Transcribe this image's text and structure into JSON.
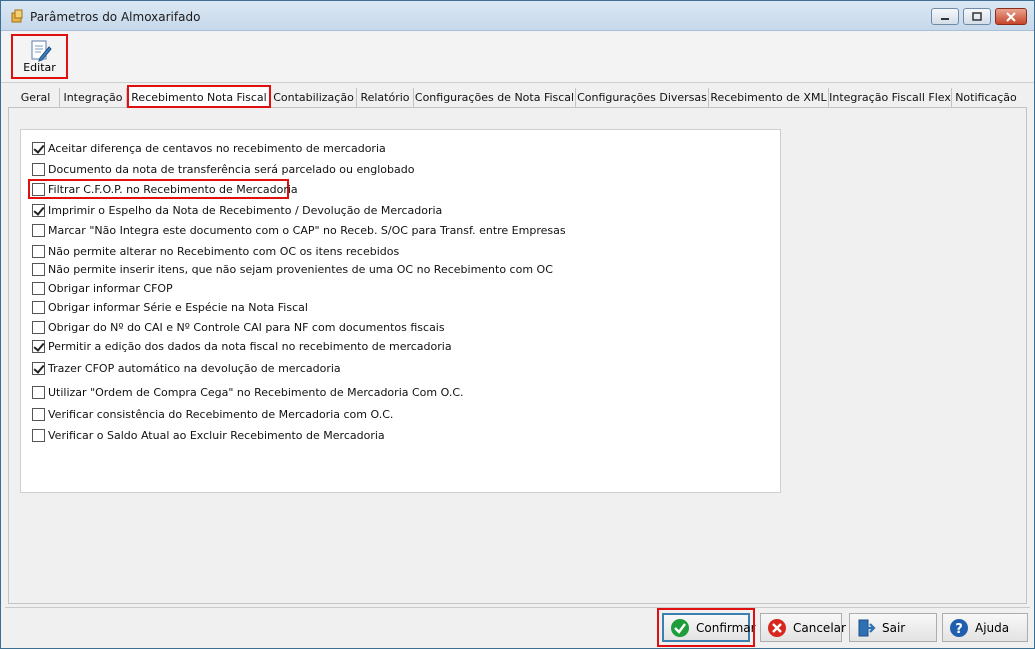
{
  "window": {
    "title": "Parâmetros do Almoxarifado"
  },
  "toolbar": {
    "edit_label": "Editar"
  },
  "tabs": [
    "Geral",
    "Integração",
    "Recebimento Nota Fiscal",
    "Contabilização",
    "Relatório",
    "Configurações de Nota Fiscal",
    "Configurações Diversas",
    "Recebimento de XML",
    "Integração Fiscall Flex",
    "Notificação"
  ],
  "active_tab": "Recebimento Nota Fiscal",
  "options": [
    {
      "label": "Aceitar diferença de centavos no recebimento de mercadoria",
      "checked": true
    },
    {
      "label": "Documento da nota de transferência será parcelado ou englobado",
      "checked": false
    },
    {
      "label": "Filtrar C.F.O.P. no Recebimento de Mercadoria",
      "checked": false
    },
    {
      "label": "Imprimir o Espelho da Nota de Recebimento / Devolução de Mercadoria",
      "checked": true
    },
    {
      "label": "Marcar \"Não Integra este documento com o CAP\" no Receb. S/OC para Transf. entre Empresas",
      "checked": false
    },
    {
      "label": "Não permite alterar no Recebimento com OC os itens recebidos",
      "checked": false
    },
    {
      "label": "Não permite inserir itens, que não sejam provenientes de uma OC no Recebimento com OC",
      "checked": false
    },
    {
      "label": "Obrigar informar CFOP",
      "checked": false
    },
    {
      "label": "Obrigar informar Série e Espécie na Nota Fiscal",
      "checked": false
    },
    {
      "label": "Obrigar do Nº do CAI e Nº Controle CAI para NF com documentos fiscais",
      "checked": false
    },
    {
      "label": "Permitir a edição dos dados da nota fiscal no recebimento de mercadoria",
      "checked": true
    },
    {
      "label": "Trazer CFOP automático na devolução de mercadoria",
      "checked": true
    },
    {
      "label": "Utilizar \"Ordem de Compra Cega\" no Recebimento de Mercadoria Com O.C.",
      "checked": false
    },
    {
      "label": "Verificar consistência do Recebimento de Mercadoria com O.C.",
      "checked": false
    },
    {
      "label": "Verificar o Saldo Atual ao Excluir Recebimento de Mercadoria",
      "checked": false
    }
  ],
  "footer": {
    "confirm_label": "Confirmar",
    "cancel_label": "Cancelar",
    "exit_label": "Sair",
    "help_label": "Ajuda"
  },
  "colors": {
    "highlight": "#e01010",
    "confirm_icon": "#1e9e3a",
    "cancel_icon": "#d6281e",
    "help_icon": "#1f5fae"
  }
}
